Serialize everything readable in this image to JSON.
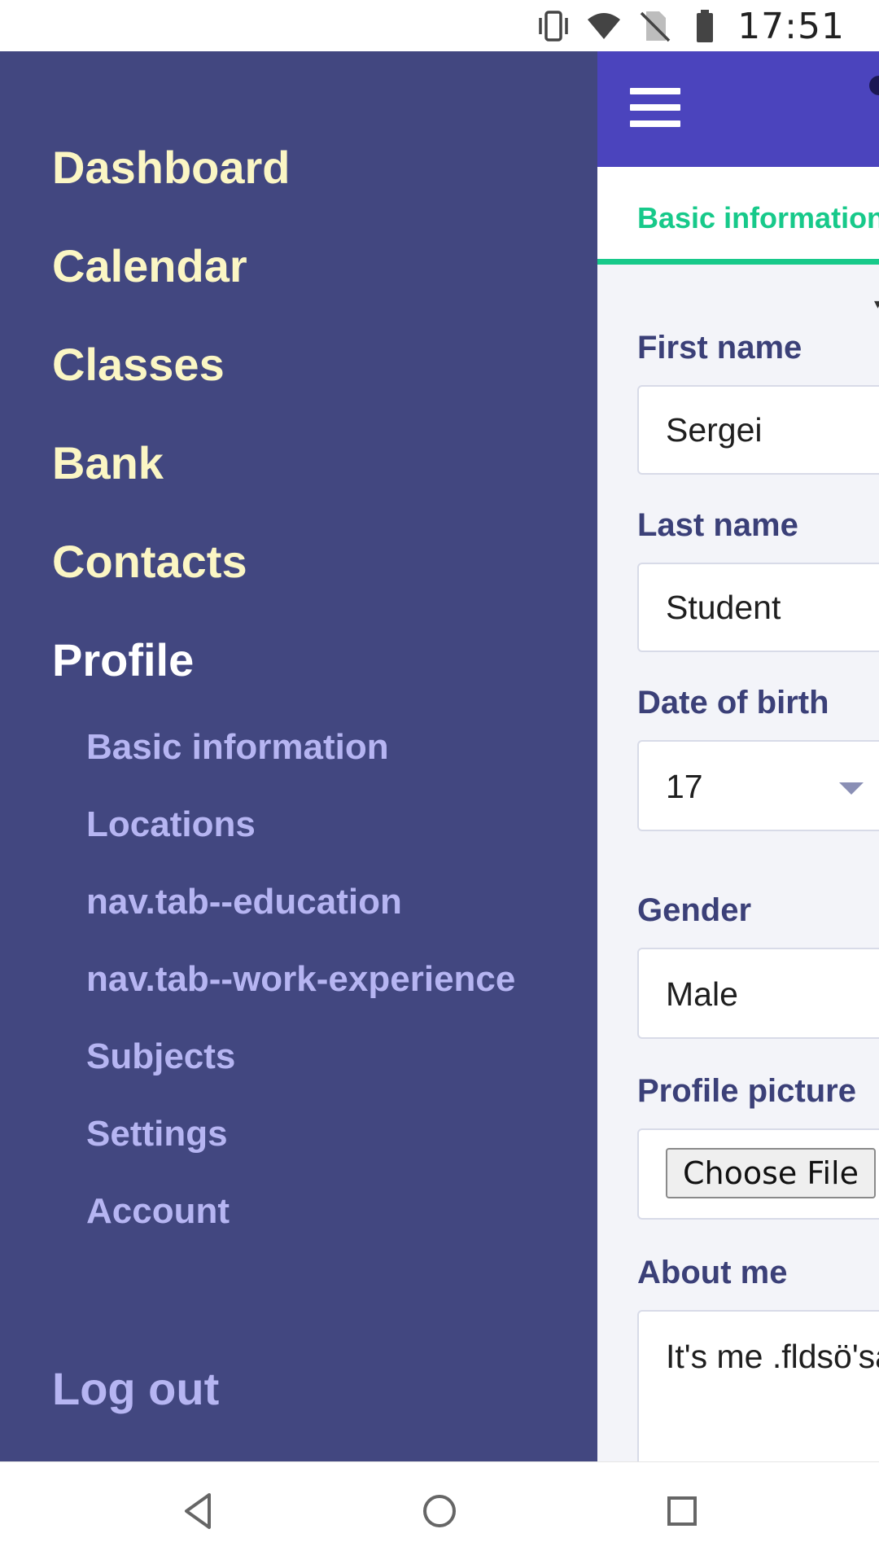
{
  "status_bar": {
    "time": "17:51",
    "icons": [
      "vibrate-icon",
      "wifi-icon",
      "no-sim-icon",
      "battery-icon"
    ]
  },
  "drawer": {
    "main_items": [
      {
        "label": "Dashboard"
      },
      {
        "label": "Calendar"
      },
      {
        "label": "Classes"
      },
      {
        "label": "Bank"
      },
      {
        "label": "Contacts"
      },
      {
        "label": "Profile"
      }
    ],
    "sub_items": [
      {
        "label": "Basic information"
      },
      {
        "label": "Locations"
      },
      {
        "label": "nav.tab--education"
      },
      {
        "label": "nav.tab--work-experience"
      },
      {
        "label": "Subjects"
      },
      {
        "label": "Settings"
      },
      {
        "label": "Account"
      }
    ],
    "logout_label": "Log out"
  },
  "app": {
    "active_tab": "Basic information",
    "form": {
      "first_name_label": "First name",
      "first_name_value": "Sergei",
      "last_name_label": "Last name",
      "last_name_value": "Student",
      "dob_label": "Date of birth",
      "dob_day_value": "17",
      "gender_label": "Gender",
      "gender_value": "Male",
      "profile_picture_label": "Profile picture",
      "choose_file_label": "Choose File",
      "about_label": "About me",
      "about_value": "It's me .fldsö'sa"
    }
  },
  "colors": {
    "drawer_bg": "#424780",
    "header_bg": "#4b44bd",
    "accent_green": "#17c98a",
    "nav_main_text": "#fbf6c4",
    "nav_sub_text": "#b6b5f2",
    "label_text": "#3b4078"
  }
}
